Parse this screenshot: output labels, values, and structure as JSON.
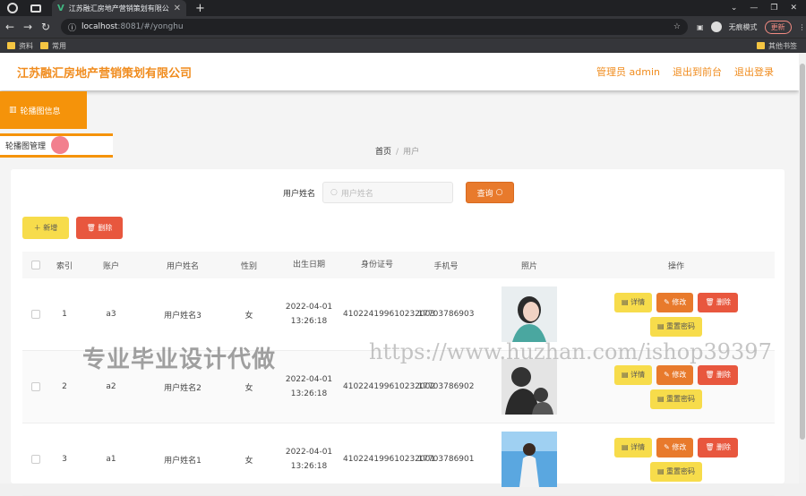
{
  "browser": {
    "tab_title": "江苏融汇房地产营销策划有限公司",
    "url_host": "localhost",
    "url_rest": ":8081/#/yonghu",
    "profile_label": "无痕模式",
    "update_label": "更新",
    "bookmarks": [
      "资料",
      "常用"
    ],
    "other_bookmarks": "其他书签"
  },
  "app": {
    "brand": "江苏融汇房地产营销策划有限公司",
    "admin_label": "管理员 admin",
    "to_front_label": "退出到前台",
    "logout_label": "退出登录"
  },
  "menu": {
    "group": "轮播图信息",
    "item": "轮播图管理"
  },
  "breadcrumb": {
    "home": "首页",
    "current": "用户"
  },
  "search": {
    "label": "用户姓名",
    "placeholder": "用户姓名",
    "button": "查询"
  },
  "actions": {
    "add": "新增",
    "delete": "删除"
  },
  "table": {
    "headers": [
      "索引",
      "账户",
      "用户姓名",
      "性别",
      "出生日期",
      "身份证号",
      "手机号",
      "照片",
      "操作"
    ],
    "rows": [
      {
        "index": "1",
        "account": "a3",
        "name": "用户姓名3",
        "gender": "女",
        "birth": "2022-04-01 13:26:18",
        "id": "410224199610232003",
        "phone": "17703786903"
      },
      {
        "index": "2",
        "account": "a2",
        "name": "用户姓名2",
        "gender": "女",
        "birth": "2022-04-01 13:26:18",
        "id": "410224199610232002",
        "phone": "17703786902"
      },
      {
        "index": "3",
        "account": "a1",
        "name": "用户姓名1",
        "gender": "女",
        "birth": "2022-04-01 13:26:18",
        "id": "410224199610232001",
        "phone": "17703786901"
      }
    ],
    "row_buttons": {
      "detail": "详情",
      "edit": "修改",
      "delete": "删除",
      "reset": "重置密码"
    }
  },
  "watermark": {
    "left": "专业毕业设计代做",
    "right": "https://www.huzhan.com/ishop39397"
  }
}
